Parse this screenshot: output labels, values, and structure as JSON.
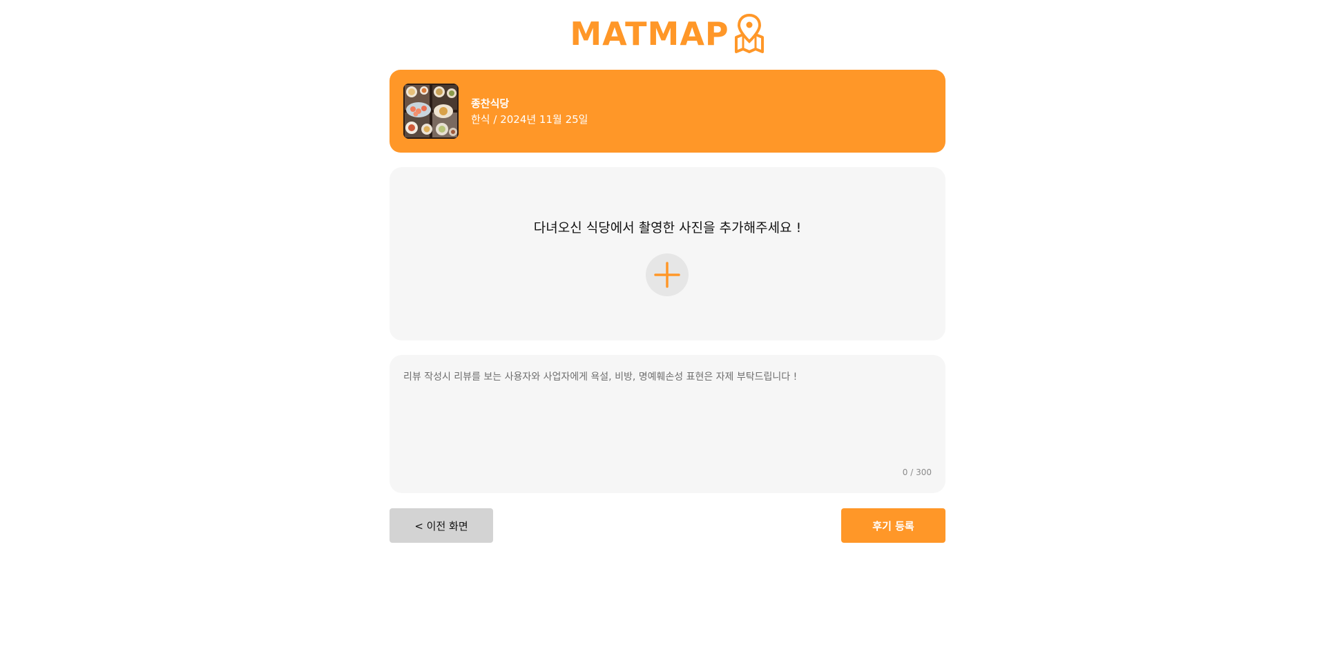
{
  "header": {
    "logo_text": "MATMAP",
    "logo_icon": "map-pin-icon",
    "brand_color": "#ff9728"
  },
  "restaurant": {
    "name": "종찬식당",
    "meta": "한식 / 2024년 11월 25일",
    "thumbnail": "food-photo"
  },
  "photo_upload": {
    "prompt": "다녀오신 식당에서 촬영한 사진을 추가해주세요 !",
    "add_icon": "plus-icon"
  },
  "review": {
    "value": "",
    "placeholder": "리뷰 작성시 리뷰를 보는 사용자와 사업자에게 욕설, 비방, 명예훼손성 표현은 자제 부탁드립니다 !",
    "char_count": "0 / 300"
  },
  "actions": {
    "back_label": "< 이전 화면",
    "submit_label": "후기 등록"
  }
}
